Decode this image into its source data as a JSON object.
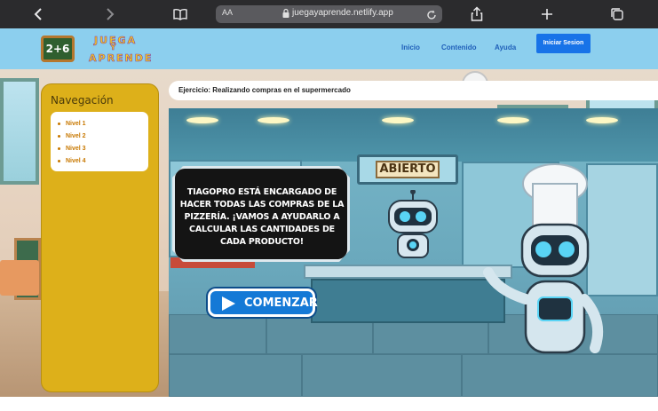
{
  "browser": {
    "reader_label": "AA",
    "url": "juegayaprende.netlify.app"
  },
  "header": {
    "logo_badge": "2+6",
    "logo_word_1": "JUEGA",
    "logo_word_2": "Y",
    "logo_word_3": "APRENDE",
    "nav": {
      "inicio": "Inicio",
      "contenido": "Contenido",
      "ayuda": "Ayuda"
    },
    "login_label": "Iniciar Sesion"
  },
  "sidebar": {
    "title": "Navegación",
    "items": [
      {
        "label": "Nivel 1"
      },
      {
        "label": "Nivel 2"
      },
      {
        "label": "Nivel 3"
      },
      {
        "label": "Nivel 4"
      }
    ]
  },
  "exercise": {
    "title": "Ejercicio: Realizando compras en el supermercado"
  },
  "game": {
    "sign_label": "ABIERTO",
    "speech": "TIAGOPRO ESTÁ ENCARGADO DE HACER TODAS LAS COMPRAS DE LA PIZZERÍA. ¡VAMOS A AYUDARLO A CALCULAR LAS CANTIDADES DE CADA PRODUCTO!",
    "start_label": "COMENZAR"
  },
  "colors": {
    "header_bg": "#8ccfee",
    "nav_link": "#1f5fb9",
    "login_button": "#1873e8",
    "sidebar": "#ddb01a",
    "sidebar_item": "#c87800",
    "start_button": "#1479d6"
  }
}
